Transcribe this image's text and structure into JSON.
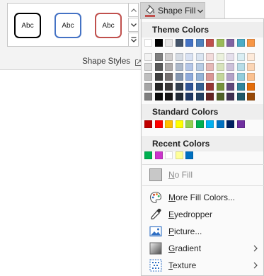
{
  "ribbon": {
    "group_label": "Shape Styles",
    "styles": [
      {
        "label": "Abc",
        "border": "#000000"
      },
      {
        "label": "Abc",
        "border": "#4472c4"
      },
      {
        "label": "Abc",
        "border": "#c0504d"
      }
    ],
    "shape_fill": {
      "label": "Shape Fill",
      "current_color": "#c0504d"
    }
  },
  "menu": {
    "theme_colors": {
      "label": "Theme Colors",
      "top_row": [
        "#ffffff",
        "#000000",
        "#e7e6e6",
        "#44546a",
        "#4472c4",
        "#4f81bd",
        "#c0504d",
        "#9bbb59",
        "#8064a2",
        "#4bacc6",
        "#f79646"
      ],
      "shade_rows": [
        [
          "#f2f2f2",
          "#7f7f7f",
          "#d0cece",
          "#d6dce4",
          "#d9e2f3",
          "#dbe5f1",
          "#f2dcdb",
          "#ebf1dd",
          "#e5e0ec",
          "#daeef3",
          "#fdeada"
        ],
        [
          "#d8d8d8",
          "#595959",
          "#aeabab",
          "#adb9ca",
          "#b4c6e7",
          "#b8cce4",
          "#e5b9b7",
          "#d7e3bc",
          "#ccc1d9",
          "#b7dde8",
          "#fbd5b5"
        ],
        [
          "#bfbfbf",
          "#3f3f3f",
          "#757070",
          "#8496b0",
          "#8eaadb",
          "#95b3d7",
          "#d99694",
          "#c3d69b",
          "#b2a2c7",
          "#92cddc",
          "#fac08f"
        ],
        [
          "#a5a5a5",
          "#262626",
          "#3a3838",
          "#323f4f",
          "#2f5496",
          "#366092",
          "#953734",
          "#76923c",
          "#5f497a",
          "#31859b",
          "#e36c09"
        ],
        [
          "#7f7f7f",
          "#0c0c0c",
          "#171616",
          "#222a35",
          "#1f3864",
          "#244061",
          "#632423",
          "#4f6128",
          "#3f3151",
          "#205867",
          "#974806"
        ]
      ]
    },
    "standard_colors": {
      "label": "Standard Colors",
      "colors": [
        "#c00000",
        "#ff0000",
        "#ffc000",
        "#ffff00",
        "#92d050",
        "#00b050",
        "#00b0f0",
        "#0070c0",
        "#002060",
        "#7030a0"
      ]
    },
    "recent_colors": {
      "label": "Recent Colors",
      "colors": [
        "#00b050",
        "#cc33cc",
        "#ffffff",
        "#ffff99",
        "#0070c0"
      ]
    },
    "items": {
      "no_fill": "No Fill",
      "more_fill_colors": "More Fill Colors...",
      "eyedropper": "Eyedropper",
      "picture": "Picture...",
      "gradient": "Gradient",
      "texture": "Texture"
    }
  }
}
